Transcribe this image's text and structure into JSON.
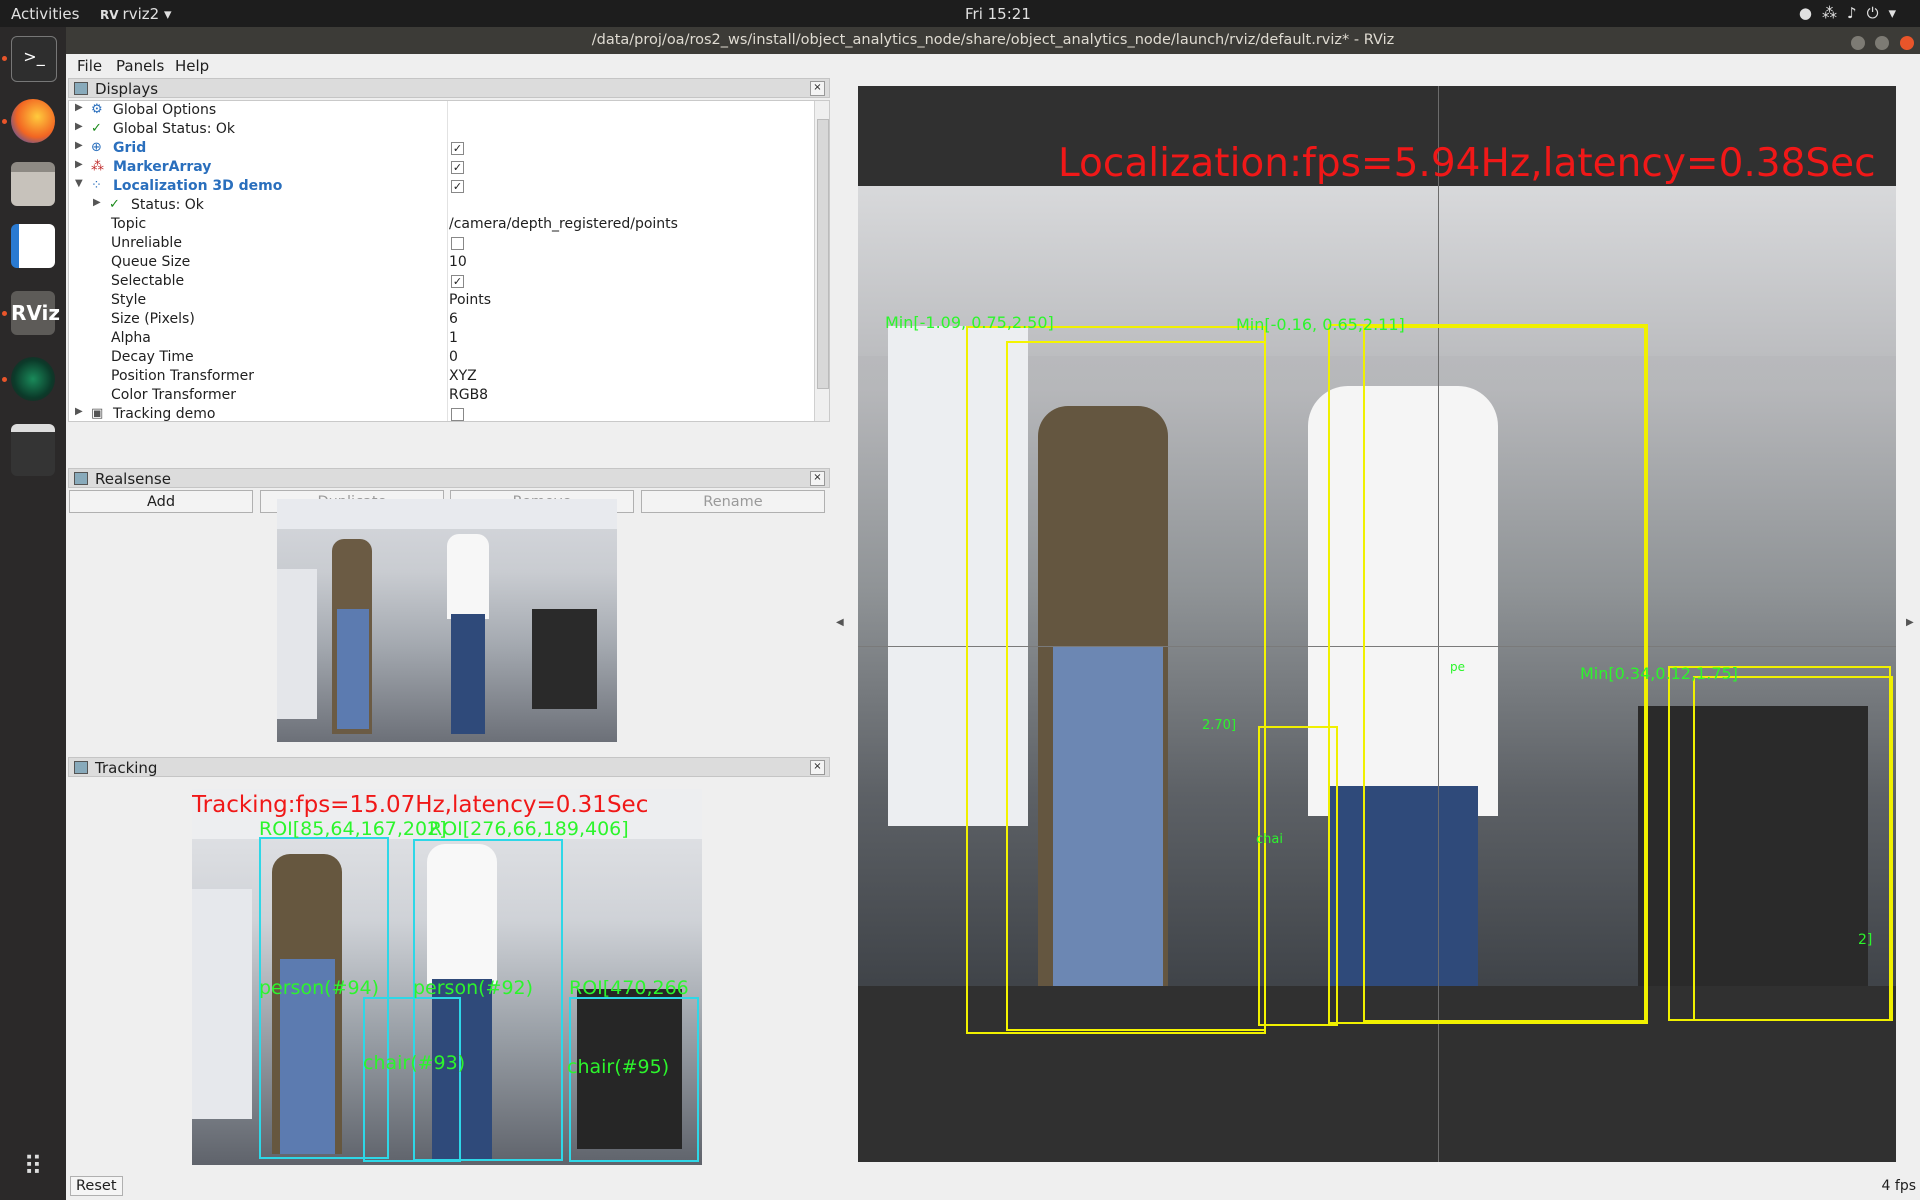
{
  "topbar": {
    "activities": "Activities",
    "app_name": "rviz2",
    "clock": "Fri 15:21"
  },
  "window": {
    "title": "/data/proj/oa/ros2_ws/install/object_analytics_node/share/object_analytics_node/launch/rviz/default.rviz* - RViz"
  },
  "menu": {
    "file": "File",
    "panels": "Panels",
    "help": "Help"
  },
  "displays": {
    "title": "Displays",
    "rows": [
      {
        "label": "Global Options",
        "value": ""
      },
      {
        "label": "Global Status: Ok",
        "value": ""
      },
      {
        "label": "Grid",
        "value": "",
        "checked": true
      },
      {
        "label": "MarkerArray",
        "value": "",
        "checked": true
      },
      {
        "label": "Localization 3D demo",
        "value": "",
        "checked": true
      },
      {
        "label": "Status: Ok",
        "value": ""
      },
      {
        "label": "Topic",
        "value": "/camera/depth_registered/points"
      },
      {
        "label": "Unreliable",
        "value": "",
        "checked": false
      },
      {
        "label": "Queue Size",
        "value": "10"
      },
      {
        "label": "Selectable",
        "value": "",
        "checked": true
      },
      {
        "label": "Style",
        "value": "Points"
      },
      {
        "label": "Size (Pixels)",
        "value": "6"
      },
      {
        "label": "Alpha",
        "value": "1"
      },
      {
        "label": "Decay Time",
        "value": "0"
      },
      {
        "label": "Position Transformer",
        "value": "XYZ"
      },
      {
        "label": "Color Transformer",
        "value": "RGB8"
      },
      {
        "label": "Tracking demo",
        "value": "",
        "checked": false
      }
    ],
    "buttons": {
      "add": "Add",
      "duplicate": "Duplicate",
      "remove": "Remove",
      "rename": "Rename"
    }
  },
  "realsense": {
    "title": "Realsense"
  },
  "tracking": {
    "title": "Tracking",
    "overlay": "Tracking:fps=15.07Hz,latency=0.31Sec",
    "roi1": "ROI[85,64,167,202]",
    "roi2": "ROI[276,66,189,406]",
    "roi3": "ROI[470,266",
    "person1": "person(#94)",
    "person2": "person(#92)",
    "chair1": "chair(#93)",
    "chair2": "chair(#95)"
  },
  "viewport": {
    "overlay": "Localization:fps=5.94Hz,latency=0.38Sec",
    "min1": "Min[-1.09, 0.75,2.50]",
    "min2": "Min[-0.16, 0.65,2.11]",
    "min3": "Min[0.34,0.12,1.75]",
    "lbl_a": "2.70]",
    "lbl_b": "chai",
    "lbl_c": "2]",
    "lbl_d": "pe"
  },
  "status": {
    "reset": "Reset",
    "fps": "4 fps"
  }
}
